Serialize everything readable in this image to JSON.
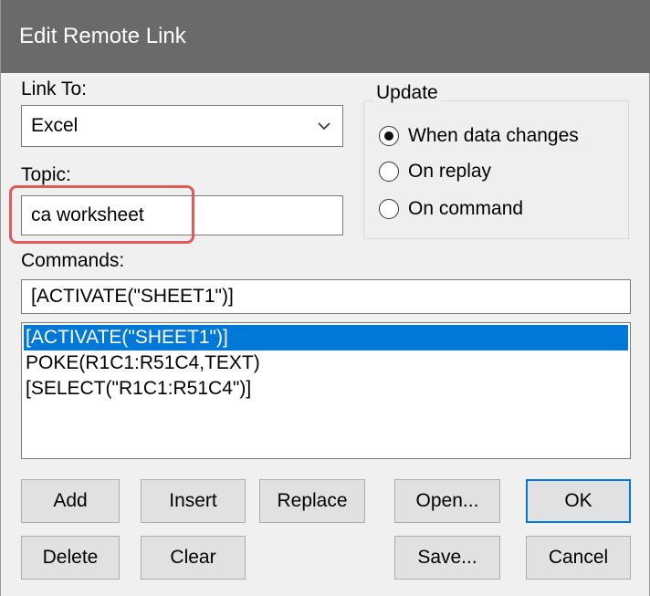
{
  "window": {
    "title": "Edit Remote Link"
  },
  "link_to": {
    "label": "Link To:",
    "selected": "Excel"
  },
  "topic": {
    "label": "Topic:",
    "value": "ca worksheet"
  },
  "update": {
    "title": "Update",
    "options": [
      {
        "label": "When data changes",
        "checked": true
      },
      {
        "label": "On replay",
        "checked": false
      },
      {
        "label": "On command",
        "checked": false
      }
    ]
  },
  "commands": {
    "label": "Commands:",
    "value": "[ACTIVATE(\"SHEET1\")]",
    "items": [
      "[ACTIVATE(\"SHEET1\")]",
      "POKE(R1C1:R51C4,TEXT)",
      "[SELECT(\"R1C1:R51C4\")]"
    ]
  },
  "buttons": {
    "add": "Add",
    "insert": "Insert",
    "replace": "Replace",
    "open": "Open...",
    "ok": "OK",
    "delete": "Delete",
    "clear": "Clear",
    "save": "Save...",
    "cancel": "Cancel"
  },
  "colors": {
    "titlebar": "#6a6a6a",
    "selection": "#0078d7",
    "highlight": "#e05a5a"
  }
}
